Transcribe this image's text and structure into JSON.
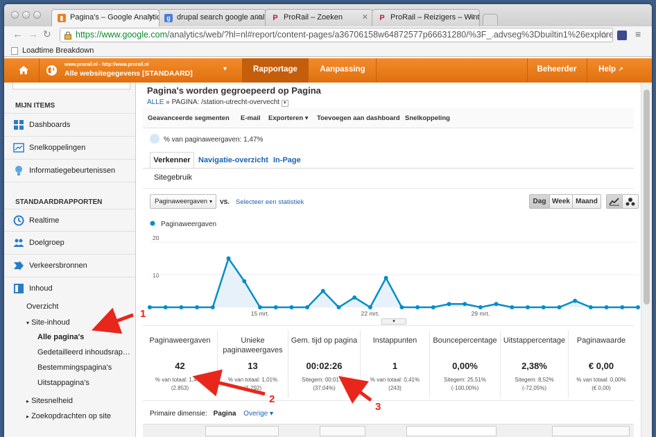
{
  "browser": {
    "tabs": [
      {
        "title": "Pagina's – Google Analytics",
        "icon": "ga-favicon-icon"
      },
      {
        "title": "drupal search google analy",
        "icon": "google-favicon-icon"
      },
      {
        "title": "ProRail – Zoeken",
        "icon": "prorail-favicon-icon"
      },
      {
        "title": "ProRail – Reizigers – Winte",
        "icon": "prorail-favicon-icon"
      }
    ],
    "url_host": "https://www.google.com",
    "url_path": "/analytics/web/?hl=nl#report/content-pages/a36706158w64872577p66631280/%3F_.advseg%3Dbuiltin1%26explorer-t…",
    "bookmark": "Loadtime Breakdown"
  },
  "header": {
    "account_line1": "www.prorail.nl - http://www.prorail.nl",
    "account_line2": "Alle websitegegevens [STANDAARD]",
    "nav_rapportage": "Rapportage",
    "nav_aanpassing": "Aanpassing",
    "nav_beheerder": "Beheerder",
    "nav_help": "Help"
  },
  "sidebar": {
    "section_mine": "MIJN ITEMS",
    "dashboards": "Dashboards",
    "snelkoppelingen": "Snelkoppelingen",
    "info": "Informatiegebeurtenissen",
    "section_std": "STANDAARDRAPPORTEN",
    "realtime": "Realtime",
    "doelgroep": "Doelgroep",
    "verkeer": "Verkeersbronnen",
    "inhoud": "Inhoud",
    "overzicht": "Overzicht",
    "site_inhoud": "Site-inhoud",
    "alle_paginas": "Alle pagina's",
    "gedetailleerd": "Gedetailleerd inhoudsrap…",
    "bestemmingen": "Bestemmingspagina's",
    "uitstap": "Uitstappagina's",
    "sitesnelheid": "Sitesnelheid",
    "zoekopdrachten": "Zoekopdrachten op site"
  },
  "report": {
    "title": "Pagina's worden gegroepeerd op Pagina",
    "crumb_all": "ALLE",
    "crumb_sep": "»",
    "crumb_label": "PAGINA:",
    "crumb_value": "/station-utrecht-overvecht",
    "actions": [
      "Geavanceerde segmenten",
      "E-mail",
      "Exporteren ▾",
      "Toevoegen aan dashboard",
      "Snelkoppeling"
    ],
    "percentage_line": "% van paginaweergaven: 1,47%",
    "tabs": [
      "Verkenner",
      "Navigatie-overzicht",
      "In-Page"
    ],
    "subtab": "Sitegebruik",
    "metric_select": "Paginaweergaven",
    "vs": "VS.",
    "select_stat": "Selecteer een statistiek",
    "periods": [
      "Dag",
      "Week",
      "Maand"
    ],
    "primary_dim_label": "Primaire dimensie:",
    "primary_dim_value": "Pagina",
    "primary_dim_other": "Overige ▾"
  },
  "chart_data": {
    "type": "area",
    "title": "",
    "legend": "Paginaweergaven",
    "y_ticks": [
      "20",
      "10"
    ],
    "ylim": [
      0,
      20
    ],
    "x_tick_labels": [
      {
        "label": "15 mrt.",
        "index": 7
      },
      {
        "label": "22 mrt.",
        "index": 14
      },
      {
        "label": "29 mrt.",
        "index": 21
      }
    ],
    "values": [
      0,
      0,
      0,
      0,
      0,
      15,
      8,
      0,
      0,
      0,
      0,
      5,
      0,
      3,
      0,
      9,
      0,
      0,
      0,
      1,
      1,
      0,
      1,
      0,
      0,
      0,
      0,
      2,
      0,
      0,
      0,
      0
    ],
    "color": "#058dc7"
  },
  "metrics": [
    {
      "title": "Paginaweergaven",
      "value": "42",
      "sub1": "% van totaal: 1,47%",
      "sub2": "(2.853)"
    },
    {
      "title": "Unieke paginaweergaves",
      "value": "13",
      "sub1": "% van totaal: 1,01%",
      "sub2": "(1.292)"
    },
    {
      "title": "Gem. tijd op pagina",
      "value": "00:02:26",
      "sub1": "Sitegem: 00:01:46",
      "sub2": "(37,04%)"
    },
    {
      "title": "Instappunten",
      "value": "1",
      "sub1": "% van totaal: 0,41%",
      "sub2": "(243)"
    },
    {
      "title": "Bouncepercentage",
      "value": "0,00%",
      "sub1": "Sitegem: 25,51%",
      "sub2": "(-100,00%)"
    },
    {
      "title": "Uitstappercentage",
      "value": "2,38%",
      "sub1": "Sitegem: 8,52%",
      "sub2": "(-72,05%)"
    },
    {
      "title": "Paginawaarde",
      "value": "€ 0,00",
      "sub1": "% van totaal: 0,00%",
      "sub2": "(€ 0,00)"
    }
  ],
  "annotations": [
    "1",
    "2",
    "3"
  ],
  "colors": {
    "accent_orange": "#e8761b",
    "chart_blue": "#058dc7",
    "annotation_red": "#e8261c",
    "link_blue": "#1a62b3"
  }
}
